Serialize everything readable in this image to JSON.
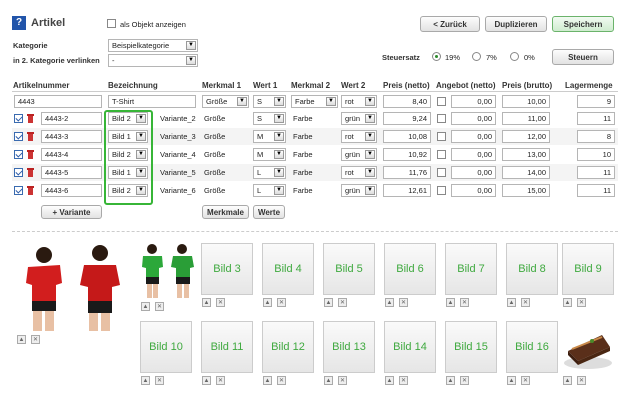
{
  "header": {
    "title": "Artikel",
    "help_icon": "?",
    "show_as_object_label": "als Objekt anzeigen"
  },
  "nav": {
    "back_label": "< Zurück",
    "duplicate_label": "Duplizieren",
    "save_label": "Speichern",
    "tax_label": "Steuern"
  },
  "category": {
    "label": "Kategorie",
    "value": "Beispielkategorie",
    "link_label": "in 2. Kategorie verlinken",
    "link_value": "-"
  },
  "tax": {
    "label": "Steuersatz",
    "options": [
      "19%",
      "7%",
      "0%"
    ],
    "selected": "19%"
  },
  "columns": [
    "Artikelnummer",
    "Bezeichnung",
    "Merkmal 1",
    "Wert 1",
    "Merkmal 2",
    "Wert 2",
    "Preis (netto)",
    "Angebot (netto)",
    "Preis (brutto)",
    "Lagermenge"
  ],
  "main_row": {
    "nr": "4443",
    "name": "T-Shirt",
    "m1": "Größe",
    "w1": "S",
    "m2": "Farbe",
    "w2": "rot",
    "netto": "8,40",
    "angebot": "0,00",
    "brutto": "10,00",
    "lager": "9"
  },
  "variants": [
    {
      "nr": "4443-2",
      "bild": "Bild 2",
      "name": "Variante_2",
      "m1": "Größe",
      "w1": "S",
      "m2": "Farbe",
      "w2": "grün",
      "netto": "9,24",
      "angebot": "0,00",
      "brutto": "11,00",
      "lager": "11"
    },
    {
      "nr": "4443-3",
      "bild": "Bild 1",
      "name": "Variante_3",
      "m1": "Größe",
      "w1": "M",
      "m2": "Farbe",
      "w2": "rot",
      "netto": "10,08",
      "angebot": "0,00",
      "brutto": "12,00",
      "lager": "8"
    },
    {
      "nr": "4443-4",
      "bild": "Bild 2",
      "name": "Variante_4",
      "m1": "Größe",
      "w1": "M",
      "m2": "Farbe",
      "w2": "grün",
      "netto": "10,92",
      "angebot": "0,00",
      "brutto": "13,00",
      "lager": "10"
    },
    {
      "nr": "4443-5",
      "bild": "Bild 1",
      "name": "Variante_5",
      "m1": "Größe",
      "w1": "L",
      "m2": "Farbe",
      "w2": "rot",
      "netto": "11,76",
      "angebot": "0,00",
      "brutto": "14,00",
      "lager": "11"
    },
    {
      "nr": "4443-6",
      "bild": "Bild 2",
      "name": "Variante_6",
      "m1": "Größe",
      "w1": "L",
      "m2": "Farbe",
      "w2": "grün",
      "netto": "12,61",
      "angebot": "0,00",
      "brutto": "15,00",
      "lager": "11"
    }
  ],
  "actions": {
    "add_variant_label": "+ Variante",
    "features_label": "Merkmale",
    "values_label": "Werte"
  },
  "images": [
    "Bild 3",
    "Bild 4",
    "Bild 5",
    "Bild 6",
    "Bild 7",
    "Bild 8",
    "Bild 9",
    "Bild 10",
    "Bild 11",
    "Bild 12",
    "Bild 13",
    "Bild 14",
    "Bild 15",
    "Bild 16"
  ],
  "colors": {
    "accent_green": "#3fa93f",
    "highlight_green": "#37b537",
    "help_blue": "#2255aa"
  }
}
